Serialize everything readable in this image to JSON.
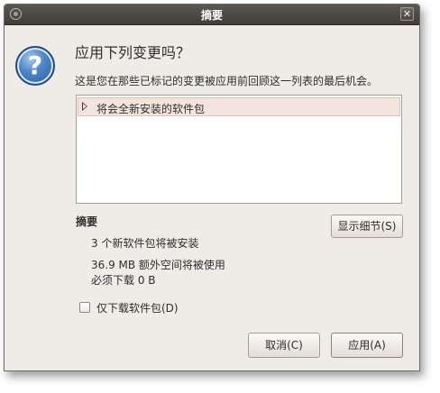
{
  "window": {
    "title": "摘要",
    "close_glyph": "✕"
  },
  "dialog": {
    "icon_glyph": "?",
    "heading": "应用下列变更吗？",
    "description": "这是您在那些已标记的变更被应用前回顾这一列表的最后机会。"
  },
  "changes_list": {
    "rows": [
      {
        "label": "将会全新安装的软件包",
        "expanded": false
      }
    ]
  },
  "summary": {
    "title": "摘要",
    "new_packages": "3 个新软件包将被安装",
    "disk_space": "36.9 MB 额外空间将被使用",
    "download_size": "必须下载 0  B"
  },
  "buttons": {
    "show_details": "显示细节(S)",
    "cancel": "取消(C)",
    "apply": "应用(A)"
  },
  "options": {
    "download_only_label": "仅下载软件包(D)",
    "download_only_checked": false
  },
  "icons": {
    "window_menu": "window-menu-icon",
    "close": "close-icon",
    "question": "question-icon",
    "expander": "expander-triangle-icon"
  }
}
